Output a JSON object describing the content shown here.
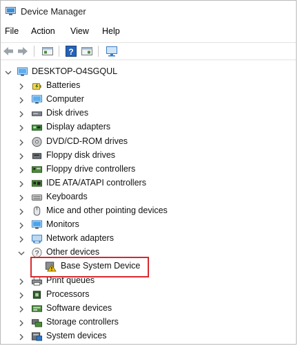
{
  "window": {
    "title": "Device Manager",
    "icon": "device-manager-icon"
  },
  "menu": [
    {
      "label": "File"
    },
    {
      "label": "Action"
    },
    {
      "label": "View"
    },
    {
      "label": "Help"
    }
  ],
  "toolbar": [
    {
      "icon": "back-arrow-icon"
    },
    {
      "icon": "forward-arrow-icon"
    },
    {
      "icon": "properties-icon"
    },
    {
      "icon": "help-icon"
    },
    {
      "icon": "driver-panel-icon"
    },
    {
      "icon": "monitor-scan-icon"
    }
  ],
  "tree": {
    "root": {
      "label": "DESKTOP-O4SGQUL",
      "expanded": true,
      "icon": "computer-icon"
    },
    "categories": [
      {
        "label": "Batteries",
        "icon": "battery-icon",
        "expanded": false
      },
      {
        "label": "Computer",
        "icon": "computer-icon",
        "expanded": false
      },
      {
        "label": "Disk drives",
        "icon": "disk-drive-icon",
        "expanded": false
      },
      {
        "label": "Display adapters",
        "icon": "display-adapter-icon",
        "expanded": false
      },
      {
        "label": "DVD/CD-ROM drives",
        "icon": "dvd-drive-icon",
        "expanded": false
      },
      {
        "label": "Floppy disk drives",
        "icon": "floppy-drive-icon",
        "expanded": false
      },
      {
        "label": "Floppy drive controllers",
        "icon": "floppy-controller-icon",
        "expanded": false
      },
      {
        "label": "IDE ATA/ATAPI controllers",
        "icon": "ide-controller-icon",
        "expanded": false
      },
      {
        "label": "Keyboards",
        "icon": "keyboard-icon",
        "expanded": false
      },
      {
        "label": "Mice and other pointing devices",
        "icon": "mouse-icon",
        "expanded": false
      },
      {
        "label": "Monitors",
        "icon": "monitor-icon",
        "expanded": false
      },
      {
        "label": "Network adapters",
        "icon": "network-adapter-icon",
        "expanded": false
      },
      {
        "label": "Other devices",
        "icon": "unknown-device-icon",
        "expanded": true,
        "children": [
          {
            "label": "Base System Device",
            "icon": "warning-device-icon",
            "highlighted": true
          }
        ]
      },
      {
        "label": "Print queues",
        "icon": "printer-icon",
        "expanded": false
      },
      {
        "label": "Processors",
        "icon": "processor-icon",
        "expanded": false
      },
      {
        "label": "Software devices",
        "icon": "software-device-icon",
        "expanded": false
      },
      {
        "label": "Storage controllers",
        "icon": "storage-controller-icon",
        "expanded": false
      },
      {
        "label": "System devices",
        "icon": "system-device-icon",
        "expanded": false
      }
    ]
  },
  "colors": {
    "highlight_border": "#d9272d",
    "warning": "#f2c200",
    "accent": "#1f7ad1"
  }
}
